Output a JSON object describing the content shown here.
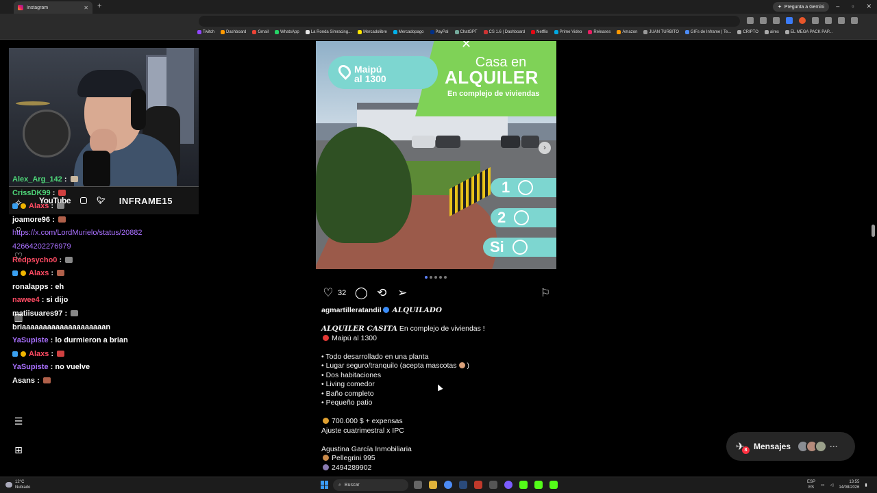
{
  "browser": {
    "tab_title": "Instagram",
    "gemini_label": "Pregunta a Gemini",
    "bookmarks": [
      "Twitch",
      "Dashboard",
      "Gmail",
      "WhatsApp",
      "La Ronda Simracing...",
      "Mercadolibre",
      "Mercadopago",
      "PayPal",
      "ChatGPT",
      "CS 1.6 | Dashboard",
      "Netflix",
      "Prime Video",
      "Releases",
      "Amazon",
      "JUAN TURBITO",
      "GIFs de Inframe | Te...",
      "CRIPTO",
      "aires",
      "EL MEGA PACK PAP..."
    ]
  },
  "stream": {
    "social": {
      "youtube": "YouTube",
      "handle": "INFRAME15"
    },
    "chat": [
      {
        "user": "Alex_Arg_142",
        "color": "#4fd87a",
        "msg": ""
      },
      {
        "user": "CrissDK99",
        "color": "#4fd87a",
        "msg": ""
      },
      {
        "user": "Alaxs",
        "color": "#ff4b63",
        "msg": ""
      },
      {
        "user": "joamore96",
        "color": "#ffffff",
        "msg": ""
      },
      {
        "user": "",
        "color": "#a970ff",
        "msg": "https://x.com/LordMurielo/status/20882"
      },
      {
        "user": "",
        "color": "#a970ff",
        "msg": "42664202276979"
      },
      {
        "user": "Redpsycho0",
        "color": "#ff4b63",
        "msg": ""
      },
      {
        "user": "Alaxs",
        "color": "#ff4b63",
        "msg": ""
      },
      {
        "user": "ronalapps",
        "color": "#ffffff",
        "msg": "eh"
      },
      {
        "user": "nawee4",
        "color": "#ff4b63",
        "msg": "si dijo"
      },
      {
        "user": "matiisuares97",
        "color": "#ffffff",
        "msg": ""
      },
      {
        "user": "",
        "color": "#ffffff",
        "msg": "briaaaaaaaaaaaaaaaaaaaan"
      },
      {
        "user": "YaSupiste",
        "color": "#a970ff",
        "msg": "lo durmieron a brian"
      },
      {
        "user": "Alaxs",
        "color": "#ff4b63",
        "msg": ""
      },
      {
        "user": "YaSupiste",
        "color": "#a970ff",
        "msg": "no vuelve"
      },
      {
        "user": "Asans",
        "color": "#ffffff",
        "msg": ""
      }
    ]
  },
  "post": {
    "image": {
      "location": "Maipú",
      "location_line2": "al 1300",
      "title_small": "Casa en",
      "title_big": "ALQUILER",
      "subtitle": "En complejo de viviendas",
      "bath_count": "1",
      "bed_count": "2",
      "garage": "Si"
    },
    "likes": "32",
    "username": "agmartilleratandil",
    "tag": "ALQUILADO",
    "caption": [
      {
        "bold": "ALQUILER CASITA",
        "text": " En complejo de viviendas !"
      },
      {
        "emoji": "#e53935",
        "text": "Maipú al 1300"
      },
      {
        "text": ""
      },
      {
        "text": "• Todo desarrollado en una planta"
      },
      {
        "text": "• Lugar seguro/tranquilo (acepta mascotas",
        "emoji_after": "#d9a07a",
        "tail": ")"
      },
      {
        "text": "• Dos habitaciones"
      },
      {
        "text": "• Living comedor"
      },
      {
        "text": "• Baño completo"
      },
      {
        "text": "• Pequeño patio"
      },
      {
        "text": ""
      },
      {
        "emoji": "#e0a030",
        "text": "700.000 $ + expensas"
      },
      {
        "text": "Ajuste cuatrimestral x IPC"
      },
      {
        "text": ""
      },
      {
        "text": "Agustina García Inmobiliaria"
      },
      {
        "emoji": "#c98a4a",
        "text": "Pellegrini 995"
      },
      {
        "emoji": "#8a7ab0",
        "text": "2494289902"
      }
    ],
    "messages": {
      "label": "Mensajes",
      "count": "8"
    }
  },
  "taskbar": {
    "temp": "12°C",
    "weather": "Nublado",
    "search": "Buscar",
    "lang1": "ESP",
    "lang2": "ES",
    "time": "13:55",
    "date": "14/08/2026"
  }
}
